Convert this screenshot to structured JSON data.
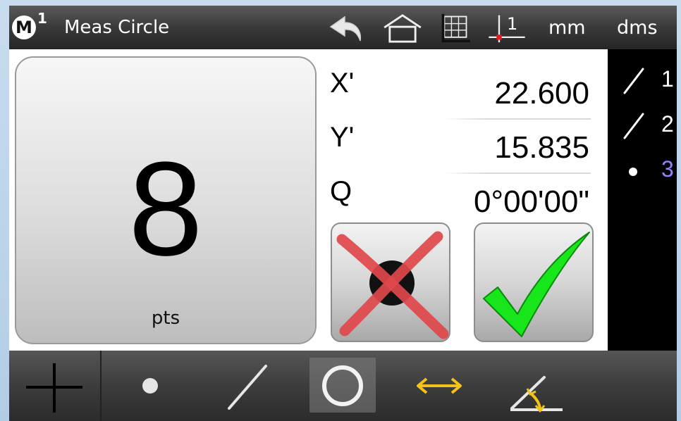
{
  "topbar": {
    "mode_letter": "M",
    "mode_number": "1",
    "title": "Meas Circle",
    "units": "mm",
    "angle_format": "dms",
    "datum_number": "1"
  },
  "points_panel": {
    "count": "8",
    "label": "pts"
  },
  "coordinates": [
    {
      "label": "X'",
      "value": "22.600"
    },
    {
      "label": "Y'",
      "value": "15.835"
    },
    {
      "label": "Q",
      "value": "0°00'00\""
    }
  ],
  "feature_list": [
    {
      "number": "1",
      "icon": "line-icon",
      "active": false
    },
    {
      "number": "2",
      "icon": "line-icon",
      "active": false
    },
    {
      "number": "3",
      "icon": "point-icon",
      "active": true
    }
  ],
  "bottom_tools": [
    {
      "name": "crosshair-icon"
    },
    {
      "name": "point-icon"
    },
    {
      "name": "line-icon"
    },
    {
      "name": "circle-icon",
      "selected": true
    },
    {
      "name": "distance-icon"
    },
    {
      "name": "angle-icon"
    }
  ],
  "colors": {
    "accept_green": "#17e61b",
    "cancel_red": "#e0484c",
    "active_feature": "#8f86ff",
    "measure_yellow": "#f3c21b"
  }
}
